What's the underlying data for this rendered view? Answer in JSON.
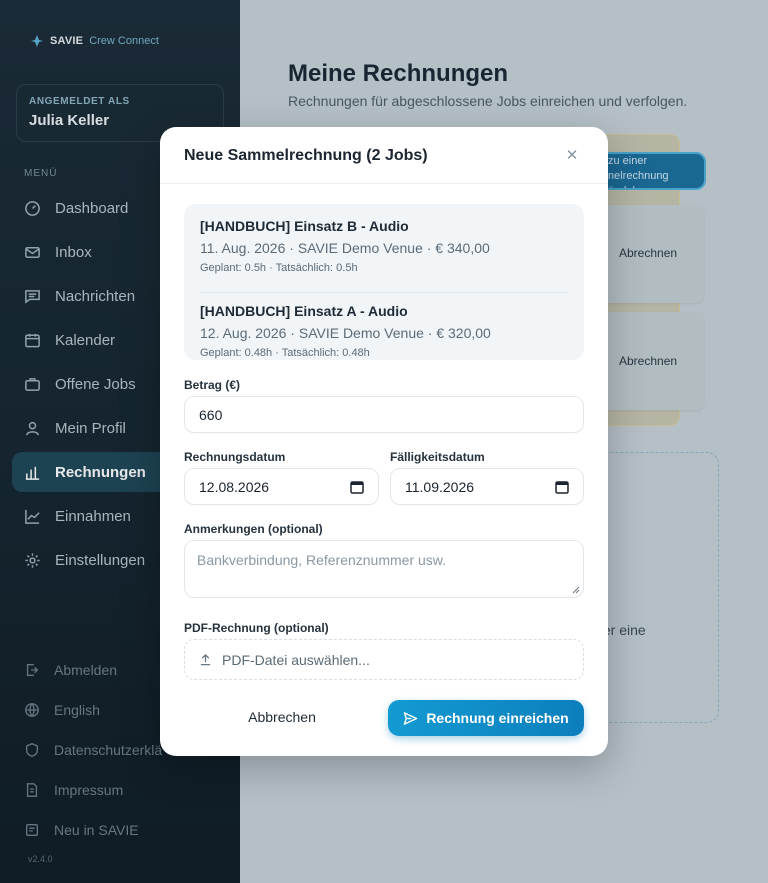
{
  "brand": {
    "name": "SAVIE",
    "sub": "Crew Connect"
  },
  "user": {
    "label": "ANGEMELDET ALS",
    "name": "Julia Keller"
  },
  "menu_label": "MENÜ",
  "nav": [
    {
      "label": "Dashboard",
      "icon": "dashboard-icon"
    },
    {
      "label": "Inbox",
      "icon": "mail-icon"
    },
    {
      "label": "Nachrichten",
      "icon": "message-icon"
    },
    {
      "label": "Kalender",
      "icon": "calendar-icon"
    },
    {
      "label": "Offene Jobs",
      "icon": "briefcase-icon"
    },
    {
      "label": "Mein Profil",
      "icon": "user-icon"
    },
    {
      "label": "Rechnungen",
      "icon": "bar-chart-icon",
      "active": true
    },
    {
      "label": "Einnahmen",
      "icon": "line-chart-icon"
    },
    {
      "label": "Einstellungen",
      "icon": "gear-icon"
    }
  ],
  "bottom_nav": [
    {
      "label": "Abmelden",
      "icon": "logout-icon"
    },
    {
      "label": "English",
      "icon": "globe-icon"
    },
    {
      "label": "Datenschutzerklä",
      "icon": "shield-icon"
    },
    {
      "label": "Impressum",
      "icon": "document-icon"
    },
    {
      "label": "Neu in SAVIE",
      "icon": "news-icon"
    }
  ],
  "version": "v2.4.0",
  "page": {
    "title": "Meine Rechnungen",
    "subtitle": "Rechnungen für abgeschlossene Jobs einreichen und verfolgen.",
    "bundle_button": "zu einer\nnelrechnung\nündeln",
    "job_action": "Abrechnen",
    "dropzone_text": "hier eine"
  },
  "modal": {
    "title": "Neue Sammelrechnung (2 Jobs)",
    "jobs": [
      {
        "title": "[HANDBUCH] Einsatz B - Audio",
        "meta": "11. Aug. 2026 · SAVIE Demo Venue · € 340,00",
        "hours": "Geplant: 0.5h · Tatsächlich: 0.5h"
      },
      {
        "title": "[HANDBUCH] Einsatz A - Audio",
        "meta": "12. Aug. 2026 · SAVIE Demo Venue · € 320,00",
        "hours": "Geplant: 0.48h · Tatsächlich: 0.48h"
      }
    ],
    "amount_label": "Betrag (€)",
    "amount_value": "660",
    "invoice_date_label": "Rechnungsdatum",
    "invoice_date_value": "12.08.2026",
    "due_date_label": "Fälligkeitsdatum",
    "due_date_value": "11.09.2026",
    "notes_label": "Anmerkungen (optional)",
    "notes_placeholder": "Bankverbindung, Referenznummer usw.",
    "pdf_label": "PDF-Rechnung (optional)",
    "pdf_placeholder": "PDF-Datei auswählen...",
    "cancel_label": "Abbrechen",
    "submit_label": "Rechnung einreichen"
  },
  "colors": {
    "accent": "#0b8ccb",
    "sidebar": "#15232d",
    "active_nav": "#1f4656"
  }
}
